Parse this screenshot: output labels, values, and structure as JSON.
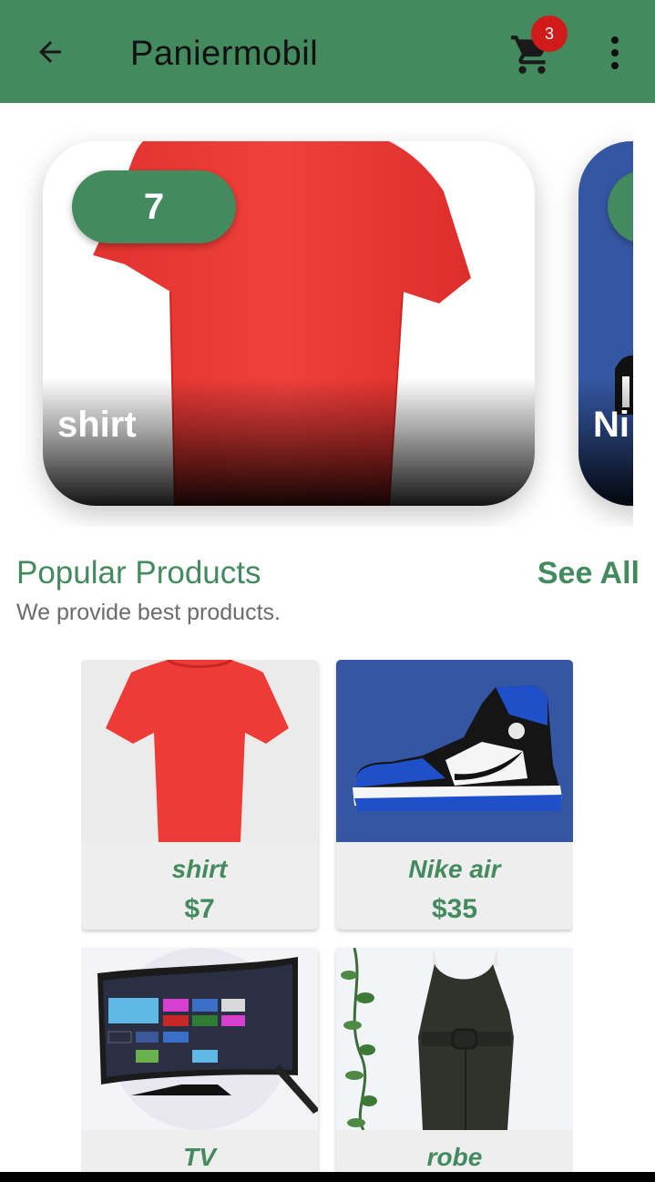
{
  "app_bar": {
    "title": "Paniermobil",
    "cart_count": "3",
    "color": "#438a5e",
    "icons": [
      "arrow-left-icon",
      "shopping-cart-icon",
      "more-vertical-icon"
    ]
  },
  "carousel": {
    "slides": [
      {
        "count": "7",
        "name": "shirt",
        "image": "red-tshirt"
      },
      {
        "count": "",
        "name": "Ni",
        "image": "sneaker-blue"
      }
    ]
  },
  "popular": {
    "title": "Popular Products",
    "subtitle": "We provide best products.",
    "see_all": "See All"
  },
  "products": [
    {
      "name": "shirt",
      "price": "$7",
      "image": "red-tshirt"
    },
    {
      "name": "Nike air",
      "price": "$35",
      "image": "nike-air-jordan"
    },
    {
      "name": "TV",
      "price": "",
      "image": "smart-tv"
    },
    {
      "name": "robe",
      "price": "",
      "image": "black-jumpsuit"
    }
  ],
  "colors": {
    "accent": "#438a5e",
    "badge": "#d11a1a",
    "sneaker_bg": "#3557a3"
  }
}
